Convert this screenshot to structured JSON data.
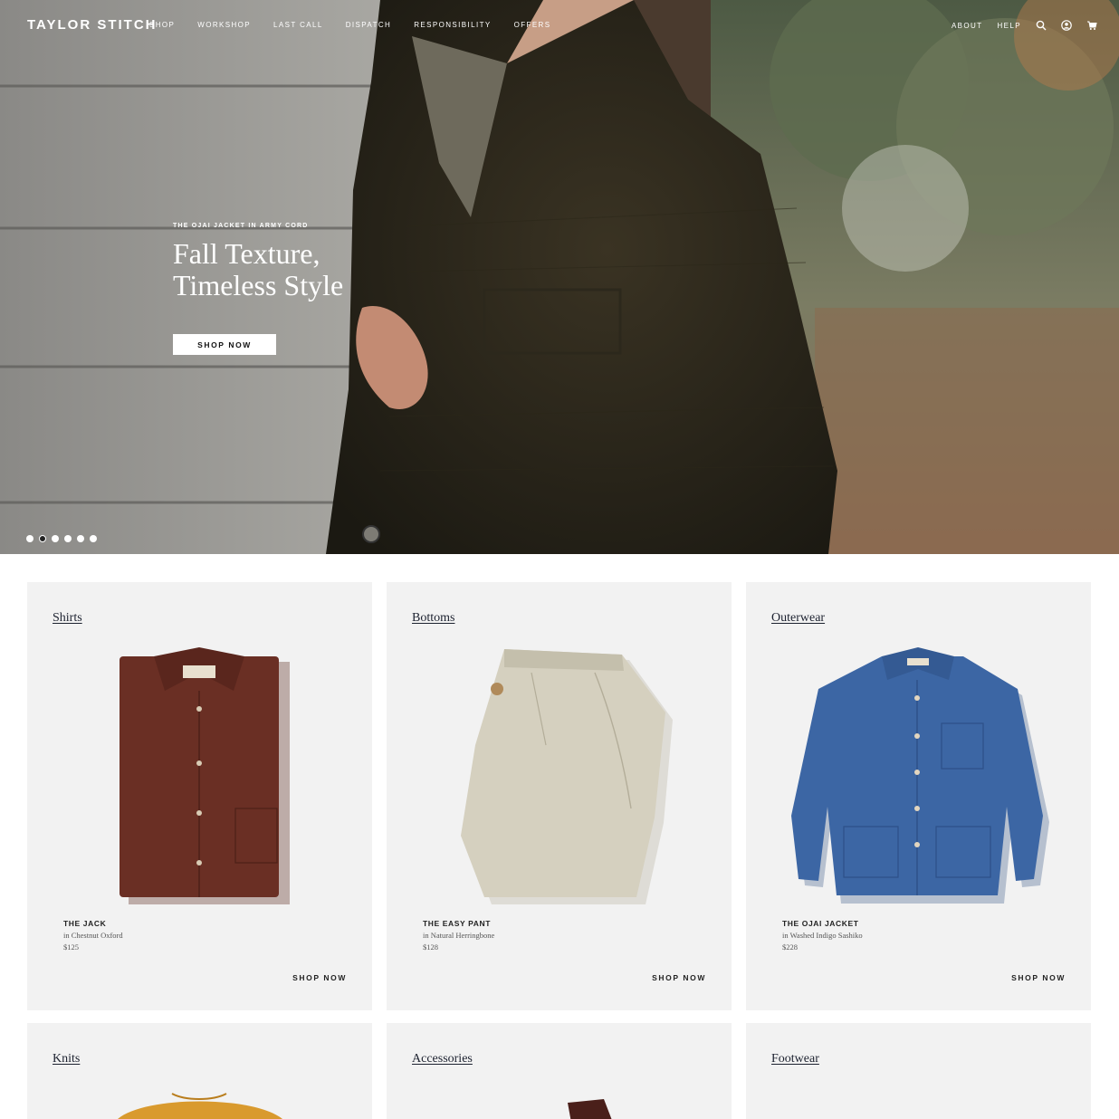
{
  "brand": {
    "name": "TAYLOR STITCH"
  },
  "nav": {
    "left": [
      "SHOP",
      "WORKSHOP",
      "LAST CALL",
      "DISPATCH",
      "RESPONSIBILITY",
      "OFFERS"
    ],
    "right": [
      "ABOUT",
      "HELP"
    ],
    "icons": [
      "search-icon",
      "account-icon",
      "cart-icon"
    ]
  },
  "hero": {
    "eyebrow": "THE OJAI JACKET IN ARMY CORD",
    "headline_line1": "Fall Texture,",
    "headline_line2": "Timeless Style",
    "cta": "SHOP NOW",
    "slides": {
      "count": 6,
      "active_index": 1
    }
  },
  "categories": [
    {
      "title": "Shirts",
      "product": "THE JACK",
      "variant": "in Chestnut Oxford",
      "price": "$125",
      "cta": "SHOP NOW",
      "color": "#6a2f24"
    },
    {
      "title": "Bottoms",
      "product": "THE EASY PANT",
      "variant": "in Natural Herringbone",
      "price": "$128",
      "cta": "SHOP NOW",
      "color": "#d5d0bf"
    },
    {
      "title": "Outerwear",
      "product": "THE OJAI JACKET",
      "variant": "in Washed Indigo Sashiko",
      "price": "$228",
      "cta": "SHOP NOW",
      "color": "#3c66a4"
    },
    {
      "title": "Knits"
    },
    {
      "title": "Accessories"
    },
    {
      "title": "Footwear"
    }
  ]
}
